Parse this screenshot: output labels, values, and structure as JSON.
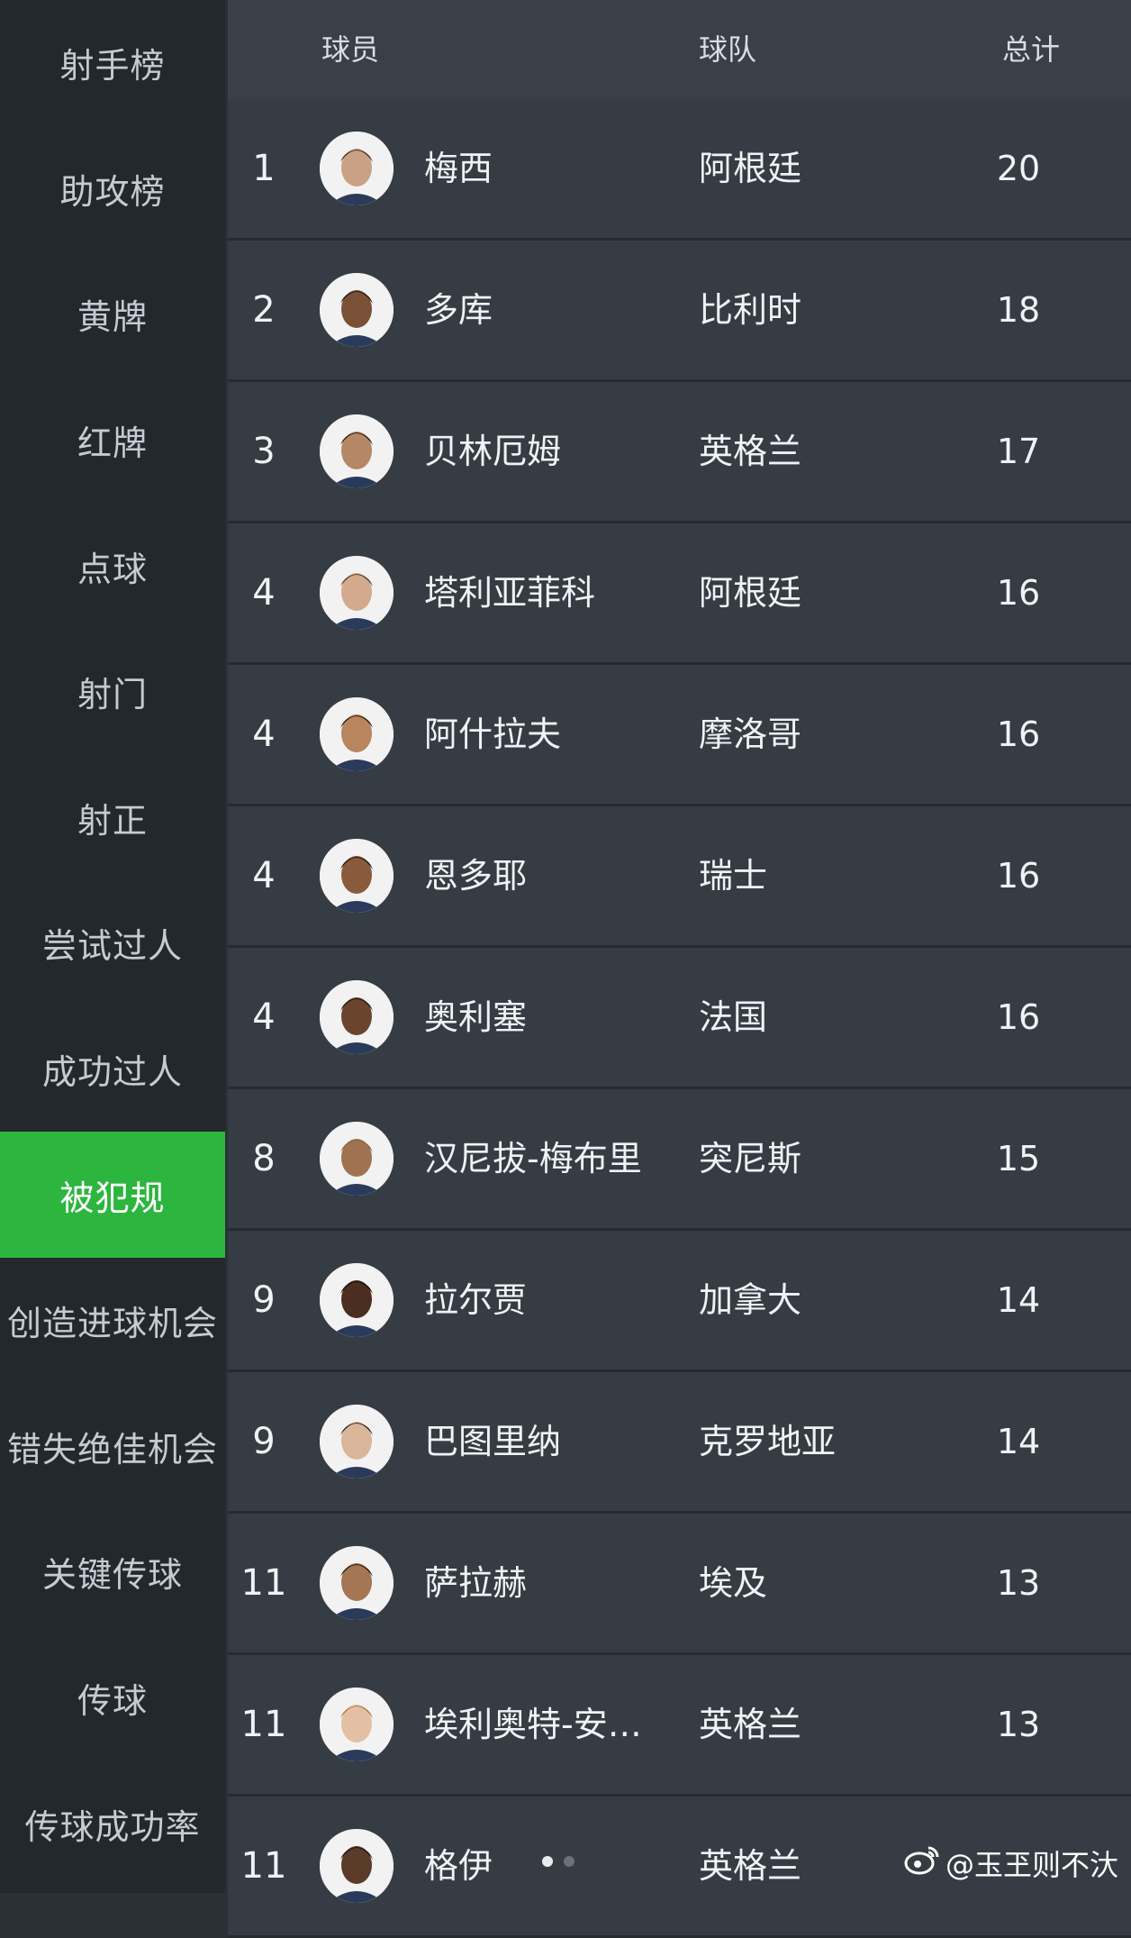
{
  "sidebar": {
    "items": [
      {
        "label": "射手榜",
        "active": false
      },
      {
        "label": "助攻榜",
        "active": false
      },
      {
        "label": "黄牌",
        "active": false
      },
      {
        "label": "红牌",
        "active": false
      },
      {
        "label": "点球",
        "active": false
      },
      {
        "label": "射门",
        "active": false
      },
      {
        "label": "射正",
        "active": false
      },
      {
        "label": "尝试过人",
        "active": false
      },
      {
        "label": "成功过人",
        "active": false
      },
      {
        "label": "被犯规",
        "active": true
      },
      {
        "label": "创造进球机会",
        "active": false
      },
      {
        "label": "错失绝佳机会",
        "active": false
      },
      {
        "label": "关键传球",
        "active": false
      },
      {
        "label": "传球",
        "active": false
      },
      {
        "label": "传球成功率",
        "active": false
      }
    ],
    "active_color": "#2cb53f"
  },
  "table": {
    "headers": {
      "player": "球员",
      "team": "球队",
      "total": "总计"
    },
    "rows": [
      {
        "rank": "1",
        "player": "梅西",
        "team": "阿根廷",
        "total": "20"
      },
      {
        "rank": "2",
        "player": "多库",
        "team": "比利时",
        "total": "18"
      },
      {
        "rank": "3",
        "player": "贝林厄姆",
        "team": "英格兰",
        "total": "17"
      },
      {
        "rank": "4",
        "player": "塔利亚菲科",
        "team": "阿根廷",
        "total": "16"
      },
      {
        "rank": "4",
        "player": "阿什拉夫",
        "team": "摩洛哥",
        "total": "16"
      },
      {
        "rank": "4",
        "player": "恩多耶",
        "team": "瑞士",
        "total": "16"
      },
      {
        "rank": "4",
        "player": "奥利塞",
        "team": "法国",
        "total": "16"
      },
      {
        "rank": "8",
        "player": "汉尼拔-梅布里",
        "team": "突尼斯",
        "total": "15"
      },
      {
        "rank": "9",
        "player": "拉尔贾",
        "team": "加拿大",
        "total": "14"
      },
      {
        "rank": "9",
        "player": "巴图里纳",
        "team": "克罗地亚",
        "total": "14"
      },
      {
        "rank": "11",
        "player": "萨拉赫",
        "team": "埃及",
        "total": "13"
      },
      {
        "rank": "11",
        "player": "埃利奥特-安…",
        "team": "英格兰",
        "total": "13"
      },
      {
        "rank": "11",
        "player": "格伊",
        "team": "英格兰",
        "total": ""
      }
    ]
  },
  "pager": {
    "pages": 2,
    "current": 1
  },
  "watermark": {
    "text": "@玉玊则不汏",
    "icon": "weibo-icon"
  },
  "colors": {
    "sidebar_bg": "#23282d",
    "main_bg": "#2e343a",
    "header_bg": "#394048",
    "row_bg": "#353c43"
  }
}
